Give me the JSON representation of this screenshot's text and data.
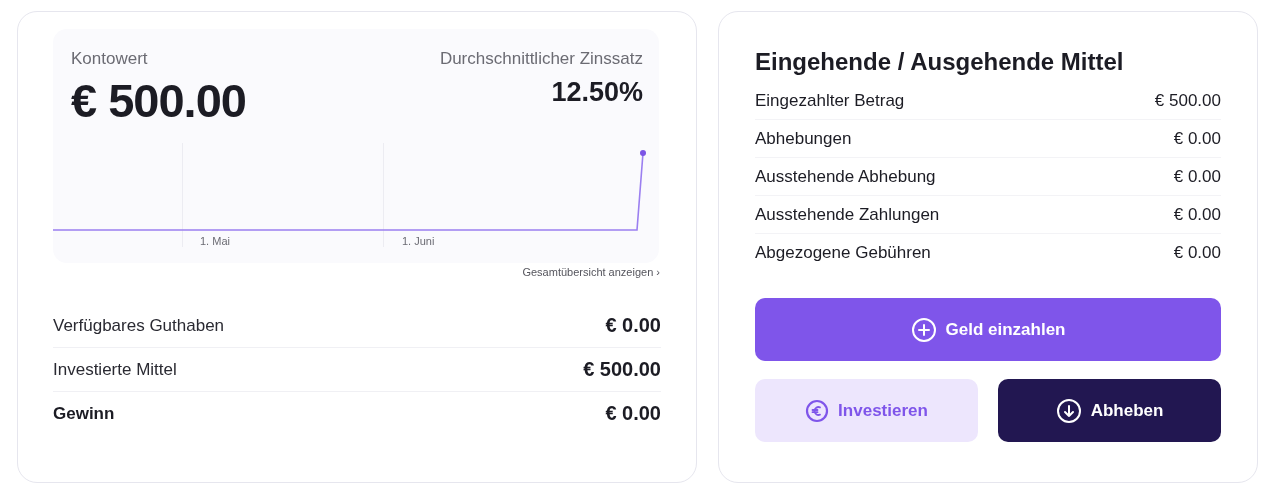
{
  "account": {
    "label": "Kontowert",
    "value": "€ 500.00",
    "rate_label": "Durchschnittlicher Zinssatz",
    "rate": "12.50%",
    "chart": {
      "kind": "picture",
      "x_labels": [
        "1. Mai",
        "1. Juni"
      ]
    },
    "overview_link": "Gesamtübersicht anzeigen ›",
    "rows": [
      {
        "label": "Verfügbares Guthaben",
        "value": "€ 0.00",
        "bold": false
      },
      {
        "label": "Investierte Mittel",
        "value": "€ 500.00",
        "bold": false
      },
      {
        "label": "Gewinn",
        "value": "€ 0.00",
        "bold": true
      }
    ]
  },
  "funds": {
    "title": "Eingehende / Ausgehende Mittel",
    "rows": [
      {
        "label": "Eingezahlter Betrag",
        "value": "€ 500.00"
      },
      {
        "label": "Abhebungen",
        "value": "€ 0.00"
      },
      {
        "label": "Ausstehende Abhebung",
        "value": "€ 0.00"
      },
      {
        "label": "Ausstehende Zahlungen",
        "value": "€ 0.00"
      },
      {
        "label": "Abgezogene Gebühren",
        "value": "€ 0.00"
      }
    ],
    "buttons": [
      {
        "label": "Geld einzahlen",
        "kind": "primary"
      },
      {
        "label": "Investieren",
        "kind": "light"
      },
      {
        "label": "Abheben",
        "kind": "dark"
      }
    ]
  }
}
